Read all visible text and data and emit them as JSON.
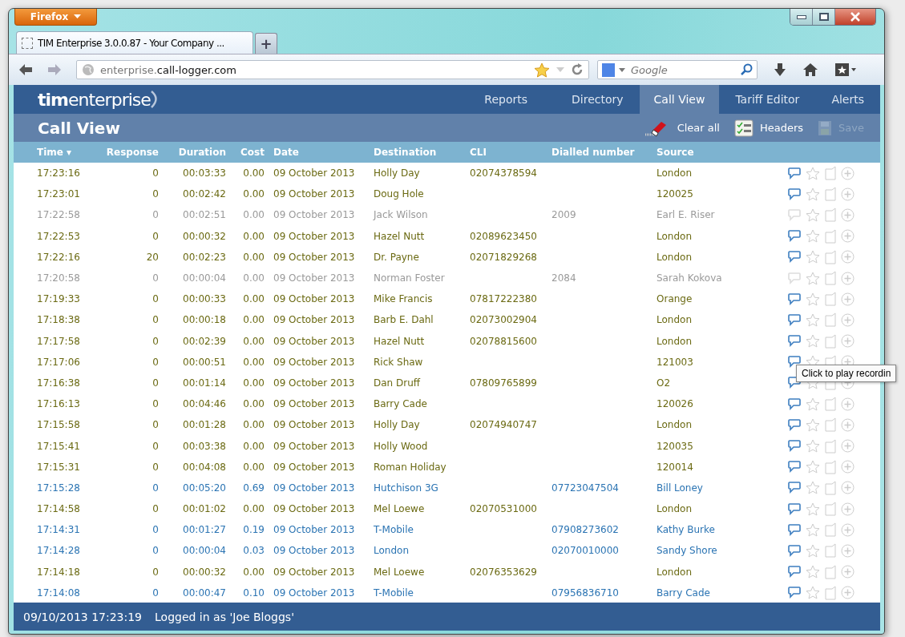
{
  "browser": {
    "menu_button": "Firefox",
    "tab_title": "TIM Enterprise 3.0.0.87 - Your Company ...",
    "new_tab": "+",
    "url_host": "enterprise.",
    "url_domain": "call-logger.com",
    "search_placeholder": "Google"
  },
  "app": {
    "logo_bold": "tim",
    "logo_light": "enterprise",
    "nav": [
      {
        "label": "Reports",
        "selected": false
      },
      {
        "label": "Directory",
        "selected": false
      },
      {
        "label": "Call View",
        "selected": true
      },
      {
        "label": "Tariff Editor",
        "selected": false
      },
      {
        "label": "Alerts",
        "selected": false
      }
    ],
    "page_title": "Call View",
    "actions": [
      {
        "kind": "clear",
        "label": "Clear all",
        "disabled": false
      },
      {
        "kind": "headers",
        "label": "Headers",
        "disabled": false
      },
      {
        "kind": "save",
        "label": "Save",
        "disabled": true
      }
    ]
  },
  "table": {
    "columns": [
      "Time ▾",
      "Response",
      "Duration",
      "Cost",
      "Date",
      "Destination",
      "CLI",
      "Dialled number",
      "Source"
    ],
    "rows": [
      {
        "kind": "internal",
        "cells": [
          "17:23:16",
          "0",
          "00:03:33",
          "0.00",
          "09 October 2013",
          "Holly Day",
          "02074378594",
          "",
          "London"
        ]
      },
      {
        "kind": "internal",
        "cells": [
          "17:23:01",
          "0",
          "00:02:42",
          "0.00",
          "09 October 2013",
          "Doug Hole",
          "",
          "",
          "120025"
        ]
      },
      {
        "kind": "missed",
        "cells": [
          "17:22:58",
          "0",
          "00:02:51",
          "0.00",
          "09 October 2013",
          "Jack Wilson",
          "",
          "2009",
          "Earl E. Riser"
        ]
      },
      {
        "kind": "internal",
        "cells": [
          "17:22:53",
          "0",
          "00:00:32",
          "0.00",
          "09 October 2013",
          "Hazel Nutt",
          "02089623450",
          "",
          "London"
        ]
      },
      {
        "kind": "internal",
        "cells": [
          "17:22:16",
          "20",
          "00:02:23",
          "0.00",
          "09 October 2013",
          "Dr. Payne",
          "02071829268",
          "",
          "London"
        ]
      },
      {
        "kind": "missed",
        "cells": [
          "17:20:58",
          "0",
          "00:00:04",
          "0.00",
          "09 October 2013",
          "Norman Foster",
          "",
          "2084",
          "Sarah Kokova"
        ]
      },
      {
        "kind": "internal",
        "cells": [
          "17:19:33",
          "0",
          "00:00:33",
          "0.00",
          "09 October 2013",
          "Mike Francis",
          "07817222380",
          "",
          "Orange"
        ]
      },
      {
        "kind": "internal",
        "cells": [
          "17:18:38",
          "0",
          "00:00:18",
          "0.00",
          "09 October 2013",
          "Barb E. Dahl",
          "02073002904",
          "",
          "London"
        ]
      },
      {
        "kind": "internal",
        "cells": [
          "17:17:58",
          "0",
          "00:02:39",
          "0.00",
          "09 October 2013",
          "Hazel Nutt",
          "02078815600",
          "",
          "London"
        ]
      },
      {
        "kind": "internal",
        "cells": [
          "17:17:06",
          "0",
          "00:00:51",
          "0.00",
          "09 October 2013",
          "Rick Shaw",
          "",
          "",
          "121003"
        ]
      },
      {
        "kind": "internal",
        "cells": [
          "17:16:38",
          "0",
          "00:01:14",
          "0.00",
          "09 October 2013",
          "Dan Druff",
          "07809765899",
          "",
          "O2"
        ]
      },
      {
        "kind": "internal",
        "cells": [
          "17:16:13",
          "0",
          "00:04:46",
          "0.00",
          "09 October 2013",
          "Barry Cade",
          "",
          "",
          "120026"
        ]
      },
      {
        "kind": "internal",
        "cells": [
          "17:15:58",
          "0",
          "00:01:28",
          "0.00",
          "09 October 2013",
          "Holly Day",
          "02074940747",
          "",
          "London"
        ]
      },
      {
        "kind": "internal",
        "cells": [
          "17:15:41",
          "0",
          "00:03:38",
          "0.00",
          "09 October 2013",
          "Holly Wood",
          "",
          "",
          "120035"
        ]
      },
      {
        "kind": "internal",
        "cells": [
          "17:15:31",
          "0",
          "00:04:08",
          "0.00",
          "09 October 2013",
          "Roman Holiday",
          "",
          "",
          "120014"
        ]
      },
      {
        "kind": "outgoing",
        "cells": [
          "17:15:28",
          "0",
          "00:05:20",
          "0.69",
          "09 October 2013",
          "Hutchison 3G",
          "",
          "07723047504",
          "Bill Loney"
        ]
      },
      {
        "kind": "internal",
        "cells": [
          "17:14:58",
          "0",
          "00:01:02",
          "0.00",
          "09 October 2013",
          "Mel Loewe",
          "02070531000",
          "",
          "London"
        ]
      },
      {
        "kind": "outgoing",
        "cells": [
          "17:14:31",
          "0",
          "00:01:27",
          "0.19",
          "09 October 2013",
          "T-Mobile",
          "",
          "07908273602",
          "Kathy Burke"
        ]
      },
      {
        "kind": "outgoing",
        "cells": [
          "17:14:28",
          "0",
          "00:00:04",
          "0.03",
          "09 October 2013",
          "London",
          "",
          "02070010000",
          "Sandy Shore"
        ]
      },
      {
        "kind": "internal",
        "cells": [
          "17:14:18",
          "0",
          "00:00:32",
          "0.00",
          "09 October 2013",
          "Mel Loewe",
          "02076353629",
          "",
          "London"
        ]
      },
      {
        "kind": "outgoing",
        "cells": [
          "17:14:08",
          "0",
          "00:00:47",
          "0.10",
          "09 October 2013",
          "T-Mobile",
          "",
          "07956836710",
          "Barry Cade"
        ]
      }
    ]
  },
  "tooltip": "Click to play recordin",
  "status_bar": {
    "datetime": "09/10/2013 17:23:19",
    "user": "Logged in as 'Joe Bloggs'"
  }
}
